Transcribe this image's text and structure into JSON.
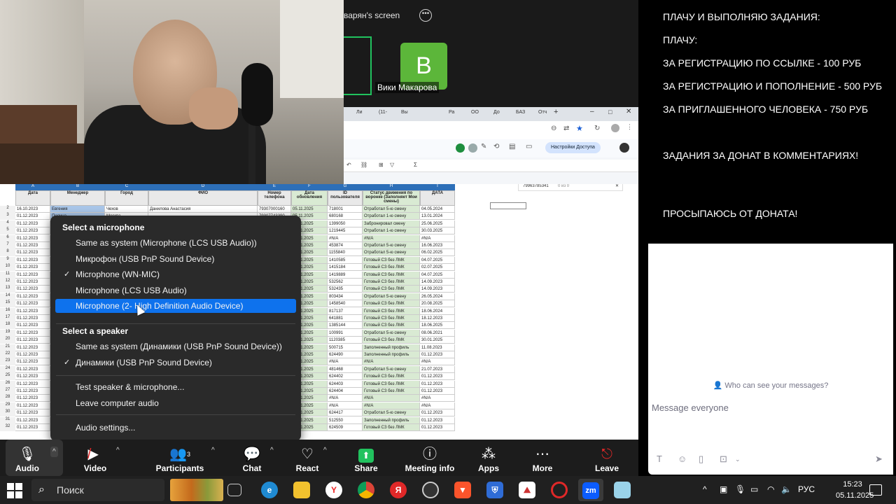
{
  "share": {
    "label": "варян's screen",
    "participant_initial": "B",
    "participant_name": "Вики Макарова"
  },
  "browser": {
    "tabs": [
      "Ли",
      "(11-",
      "Вы",
      "Ра",
      "ОО",
      "До",
      "БАЗ",
      "Отч"
    ],
    "share_button": "Настройки Доступа",
    "phone_cell": "79963785341",
    "find_count": "0 из 0"
  },
  "sheet": {
    "column_letters": [
      "A",
      "B",
      "C",
      "D",
      "E",
      "F",
      "G",
      "H",
      "I",
      "J",
      "K",
      "L"
    ],
    "headers": [
      "Дата",
      "Менеджер",
      "Город",
      "ФИО",
      "Номер телефона",
      "Дата обновления",
      "ID пользователя",
      "Статус движения по воронке (Заполняет Мои смены)",
      "ДАТА"
    ],
    "rows": [
      {
        "n": "2",
        "a": "16.10.2023",
        "b": "Евгения",
        "c": "Чехов",
        "d": "Данилова Анастасия",
        "e": "79307000160",
        "f": "05.11.2025",
        "g": "718001",
        "h": "Отработал 5-ю смену",
        "i": "04.05.2024"
      },
      {
        "n": "3",
        "a": "01.12.2023",
        "b": "Полина",
        "c": "Москва",
        "d": "",
        "e": "79307743390",
        "f": "05.11.2025",
        "g": "680168",
        "h": "Отработал 1-ю смену",
        "i": "13.01.2024"
      },
      {
        "n": "4",
        "a": "01.12.2023",
        "b": "",
        "c": "",
        "d": "",
        "e": "",
        "f": "05.11.2025",
        "g": "1399050",
        "h": "Забронировал смену",
        "i": "25.06.2025"
      },
      {
        "n": "5",
        "a": "01.12.2023",
        "b": "",
        "c": "",
        "d": "",
        "e": "",
        "f": "05.11.2025",
        "g": "1219445",
        "h": "Отработал 1-ю смену",
        "i": "30.03.2025"
      },
      {
        "n": "6",
        "a": "01.12.2023",
        "b": "",
        "c": "",
        "d": "",
        "e": "",
        "f": "05.11.2025",
        "g": "#N/A",
        "h": "#N/A",
        "i": "#N/A"
      },
      {
        "n": "7",
        "a": "01.12.2023",
        "b": "",
        "c": "",
        "d": "",
        "e": "",
        "f": "05.11.2025",
        "g": "453874",
        "h": "Отработал 5-ю смену",
        "i": "16.06.2023"
      },
      {
        "n": "8",
        "a": "01.12.2023",
        "b": "",
        "c": "",
        "d": "",
        "e": "",
        "f": "05.11.2025",
        "g": "1155840",
        "h": "Отработал 5-ю смену",
        "i": "06.02.2025"
      },
      {
        "n": "9",
        "a": "01.12.2023",
        "b": "",
        "c": "",
        "d": "",
        "e": "",
        "f": "05.11.2025",
        "g": "1410585",
        "h": "Готовый СЗ без ЛМК",
        "i": "04.07.2025"
      },
      {
        "n": "10",
        "a": "01.12.2023",
        "b": "",
        "c": "",
        "d": "",
        "e": "",
        "f": "05.11.2025",
        "g": "1415184",
        "h": "Готовый СЗ без ЛМК",
        "i": "02.07.2025"
      },
      {
        "n": "11",
        "a": "01.12.2023",
        "b": "",
        "c": "",
        "d": "",
        "e": "",
        "f": "05.11.2025",
        "g": "1419889",
        "h": "Готовый СЗ без ЛМК",
        "i": "04.07.2025"
      },
      {
        "n": "12",
        "a": "01.12.2023",
        "b": "",
        "c": "",
        "d": "",
        "e": "",
        "f": "05.11.2025",
        "g": "532562",
        "h": "Готовый СЗ без ЛМК",
        "i": "14.09.2023"
      },
      {
        "n": "13",
        "a": "01.12.2023",
        "b": "",
        "c": "",
        "d": "",
        "e": "",
        "f": "05.11.2025",
        "g": "532435",
        "h": "Готовый СЗ без ЛМК",
        "i": "14.09.2023"
      },
      {
        "n": "14",
        "a": "01.12.2023",
        "b": "",
        "c": "",
        "d": "",
        "e": "",
        "f": "05.11.2025",
        "g": "803434",
        "h": "Отработал 5-ю смену",
        "i": "26.05.2024"
      },
      {
        "n": "15",
        "a": "01.12.2023",
        "b": "",
        "c": "",
        "d": "",
        "e": "",
        "f": "05.11.2025",
        "g": "1458540",
        "h": "Готовый СЗ без ЛМК",
        "i": "20.08.2025"
      },
      {
        "n": "16",
        "a": "01.12.2023",
        "b": "",
        "c": "",
        "d": "",
        "e": "",
        "f": "05.11.2025",
        "g": "817137",
        "h": "Готовый СЗ без ЛМК",
        "i": "18.06.2024"
      },
      {
        "n": "17",
        "a": "01.12.2023",
        "b": "",
        "c": "",
        "d": "",
        "e": "",
        "f": "05.11.2025",
        "g": "641881",
        "h": "Готовый СЗ без ЛМК",
        "i": "18.12.2023"
      },
      {
        "n": "18",
        "a": "01.12.2023",
        "b": "",
        "c": "",
        "d": "",
        "e": "",
        "f": "05.11.2025",
        "g": "1385144",
        "h": "Готовый СЗ без ЛМК",
        "i": "18.06.2025"
      },
      {
        "n": "19",
        "a": "01.12.2023",
        "b": "",
        "c": "",
        "d": "",
        "e": "",
        "f": "05.11.2025",
        "g": "100991",
        "h": "Отработал 5-ю смену",
        "i": "08.06.2021"
      },
      {
        "n": "20",
        "a": "01.12.2023",
        "b": "",
        "c": "",
        "d": "",
        "e": "",
        "f": "05.11.2025",
        "g": "1120385",
        "h": "Готовый СЗ без ЛМК",
        "i": "30.01.2025"
      },
      {
        "n": "21",
        "a": "01.12.2023",
        "b": "",
        "c": "",
        "d": "",
        "e": "",
        "f": "05.11.2025",
        "g": "500715",
        "h": "Заполненный профиль",
        "i": "11.08.2023"
      },
      {
        "n": "22",
        "a": "01.12.2023",
        "b": "",
        "c": "",
        "d": "",
        "e": "",
        "f": "05.11.2025",
        "g": "624490",
        "h": "Заполненный профиль",
        "i": "01.12.2023"
      },
      {
        "n": "23",
        "a": "01.12.2023",
        "b": "",
        "c": "",
        "d": "",
        "e": "",
        "f": "05.11.2025",
        "g": "#N/A",
        "h": "#N/A",
        "i": "#N/A"
      },
      {
        "n": "24",
        "a": "01.12.2023",
        "b": "",
        "c": "",
        "d": "",
        "e": "",
        "f": "05.11.2025",
        "g": "481468",
        "h": "Отработал 5-ю смену",
        "i": "21.07.2023"
      },
      {
        "n": "25",
        "a": "01.12.2023",
        "b": "",
        "c": "",
        "d": "",
        "e": "",
        "f": "05.11.2025",
        "g": "624402",
        "h": "Готовый СЗ без ЛМК",
        "i": "01.12.2023"
      },
      {
        "n": "26",
        "a": "01.12.2023",
        "b": "",
        "c": "",
        "d": "",
        "e": "",
        "f": "05.11.2025",
        "g": "624403",
        "h": "Готовый СЗ без ЛМК",
        "i": "01.12.2023"
      },
      {
        "n": "27",
        "a": "01.12.2023",
        "b": "",
        "c": "",
        "d": "",
        "e": "",
        "f": "05.11.2025",
        "g": "624404",
        "h": "Готовый СЗ без ЛМК",
        "i": "01.12.2023"
      },
      {
        "n": "28",
        "a": "01.12.2023",
        "b": "",
        "c": "",
        "d": "",
        "e": "",
        "f": "05.11.2025",
        "g": "#N/A",
        "h": "#N/A",
        "i": "#N/A"
      },
      {
        "n": "29",
        "a": "01.12.2023",
        "b": "",
        "c": "",
        "d": "",
        "e": "",
        "f": "05.11.2025",
        "g": "#N/A",
        "h": "#N/A",
        "i": "#N/A"
      },
      {
        "n": "30",
        "a": "01.12.2023",
        "b": "",
        "c": "",
        "d": "",
        "e": "",
        "f": "05.11.2025",
        "g": "624417",
        "h": "Отработал 5-ю смену",
        "i": "01.12.2023"
      },
      {
        "n": "31",
        "a": "01.12.2023",
        "b": "",
        "c": "",
        "d": "",
        "e": "",
        "f": "05.11.2025",
        "g": "512550",
        "h": "Заполненный профиль",
        "i": "01.12.2023"
      },
      {
        "n": "32",
        "a": "01.12.2023",
        "b": "",
        "c": "",
        "d": "",
        "e": "",
        "f": "05.11.2025",
        "g": "624509",
        "h": "Готовый СЗ без ЛМК",
        "i": "01.12.2023"
      }
    ]
  },
  "audio_menu": {
    "microphone_title": "Select a microphone",
    "microphones": [
      {
        "label": "Same as system (Microphone (LCS USB Audio))",
        "checked": false,
        "selected": false
      },
      {
        "label": "Микрофон (USB PnP Sound Device)",
        "checked": false,
        "selected": false
      },
      {
        "label": "Microphone (WN-MIC)",
        "checked": true,
        "selected": false
      },
      {
        "label": "Microphone (LCS USB Audio)",
        "checked": false,
        "selected": false
      },
      {
        "label": "Microphone (2- High Definition Audio Device)",
        "checked": false,
        "selected": true
      }
    ],
    "speaker_title": "Select a speaker",
    "speakers": [
      {
        "label": "Same as system (Динамики (USB PnP Sound Device))",
        "checked": false
      },
      {
        "label": "Динамики (USB PnP Sound Device)",
        "checked": true
      }
    ],
    "test_label": "Test speaker & microphone...",
    "leave_label": "Leave computer audio",
    "settings_label": "Audio settings...",
    "checkmark": "✓"
  },
  "toolbar": {
    "audio": "Audio",
    "video": "Video",
    "participants": "Participants",
    "participants_count": "3",
    "chat": "Chat",
    "react": "React",
    "share": "Share",
    "meeting_info": "Meeting info",
    "apps": "Apps",
    "more": "More",
    "leave": "Leave"
  },
  "chat": {
    "message_lines": [
      "ПЛАЧУ И ВЫПОЛНЯЮ ЗАДАНИЯ:",
      "ПЛАЧУ:",
      " ЗА РЕГИСТРАЦИЮ ПО ССЫЛКЕ - 100 РУБ",
      "ЗА РЕГИСТРАЦИЮ И ПОПОЛНЕНИЕ - 500 РУБ",
      "ЗА ПРИГЛАШЕННОГО ЧЕЛОВЕКА - 750 РУБ",
      "ЗАДАНИЯ ЗА ДОНАТ В КОММЕНТАРИЯХ!",
      "ПРОСЫПАЮСЬ ОТ ДОНАТА!"
    ],
    "who_can_see": "Who can see your messages?",
    "placeholder": "Message everyone"
  },
  "taskbar": {
    "search_placeholder": "Поиск",
    "lang": "РУС",
    "time": "15:23",
    "date": "05.11.2025",
    "zoom_app": "zm"
  },
  "colors": {
    "accent": "#0e72ed",
    "share_green": "#21c25e",
    "avatar_green": "#5cb63a",
    "leave_red": "#e02828"
  }
}
